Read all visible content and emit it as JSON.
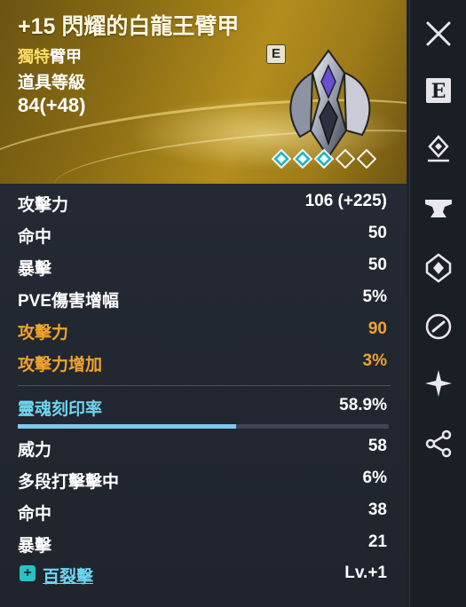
{
  "item": {
    "title": "+15 閃耀的白龍王臂甲",
    "rarity_a": "獨特",
    "rarity_b": "臂甲",
    "level_label": "道具等級",
    "level_value": "84(+48)",
    "badge": "E",
    "stars_total": 5,
    "stars_filled": 3
  },
  "stats": [
    {
      "label": "攻擊力",
      "value": "106 (+225)"
    },
    {
      "label": "命中",
      "value": "50"
    },
    {
      "label": "暴擊",
      "value": "50"
    },
    {
      "label": "PVE傷害增幅",
      "value": "5%"
    },
    {
      "label": "攻擊力",
      "value": "90"
    },
    {
      "label": "攻擊力增加",
      "value": "3%"
    }
  ],
  "soul": {
    "label": "靈魂刻印率",
    "value": "58.9%",
    "fill_fraction": 0.589
  },
  "soul_stats": [
    {
      "label": "威力",
      "value": "58"
    },
    {
      "label": "多段打擊擊中",
      "value": "6%"
    },
    {
      "label": "命中",
      "value": "38"
    },
    {
      "label": "暴擊",
      "value": "21"
    }
  ],
  "skill": {
    "label": "百裂擊",
    "value": "Lv.+1",
    "icon": "plus-icon"
  },
  "sidebar": {
    "buttons": [
      "close-icon",
      "equip-e-icon",
      "gem-upgrade-icon",
      "anvil-icon",
      "diamond-shield-icon",
      "link-circle-icon",
      "star-burst-icon",
      "share-icon"
    ],
    "badge_letter": "E"
  },
  "colors": {
    "orange": "#f0a32c",
    "cyan": "#6fd6f0",
    "gold": "#b38d1c"
  }
}
